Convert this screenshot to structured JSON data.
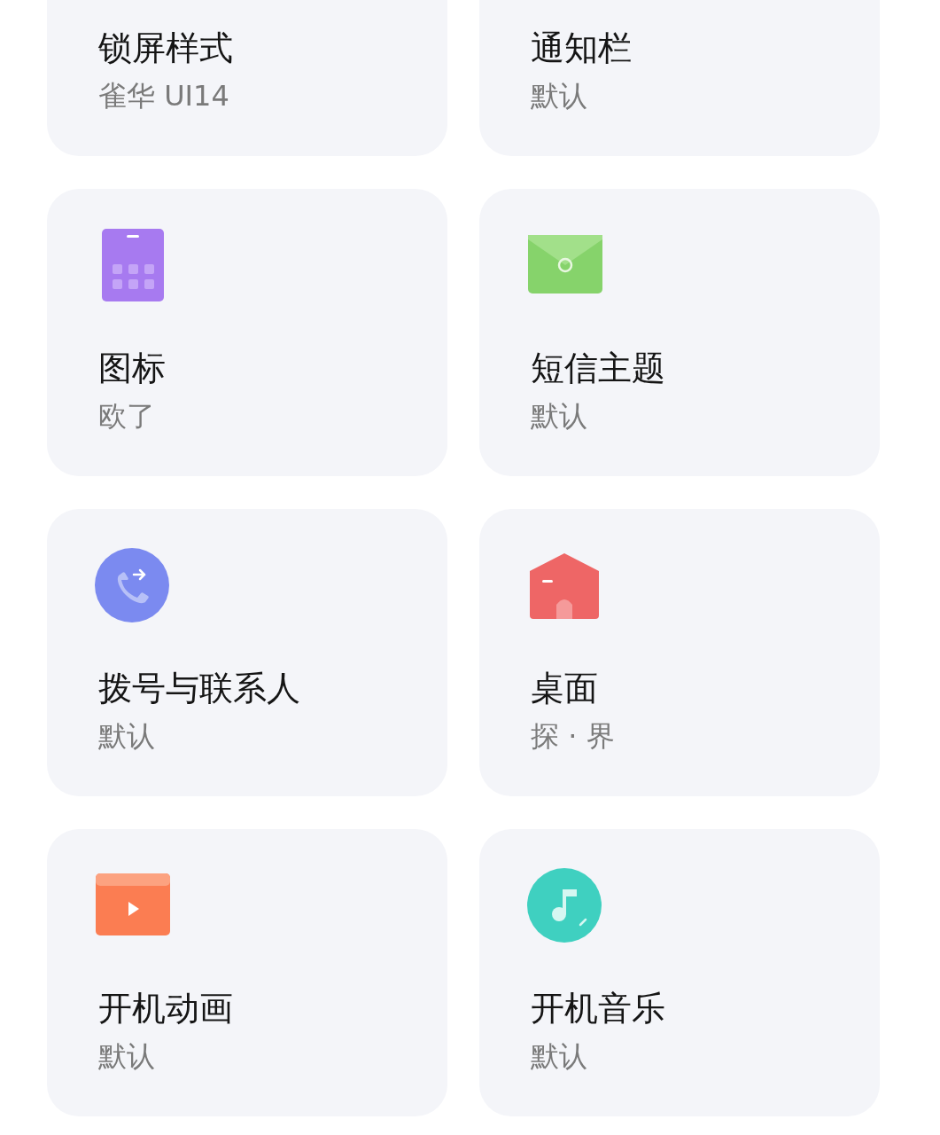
{
  "cards": [
    {
      "title": "锁屏样式",
      "subtitle": "雀华 UI14"
    },
    {
      "title": "通知栏",
      "subtitle": "默认"
    },
    {
      "title": "图标",
      "subtitle": "欧了"
    },
    {
      "title": "短信主题",
      "subtitle": "默认"
    },
    {
      "title": "拨号与联系人",
      "subtitle": "默认"
    },
    {
      "title": "桌面",
      "subtitle": "探 · 界"
    },
    {
      "title": "开机动画",
      "subtitle": "默认"
    },
    {
      "title": "开机音乐",
      "subtitle": "默认"
    }
  ]
}
